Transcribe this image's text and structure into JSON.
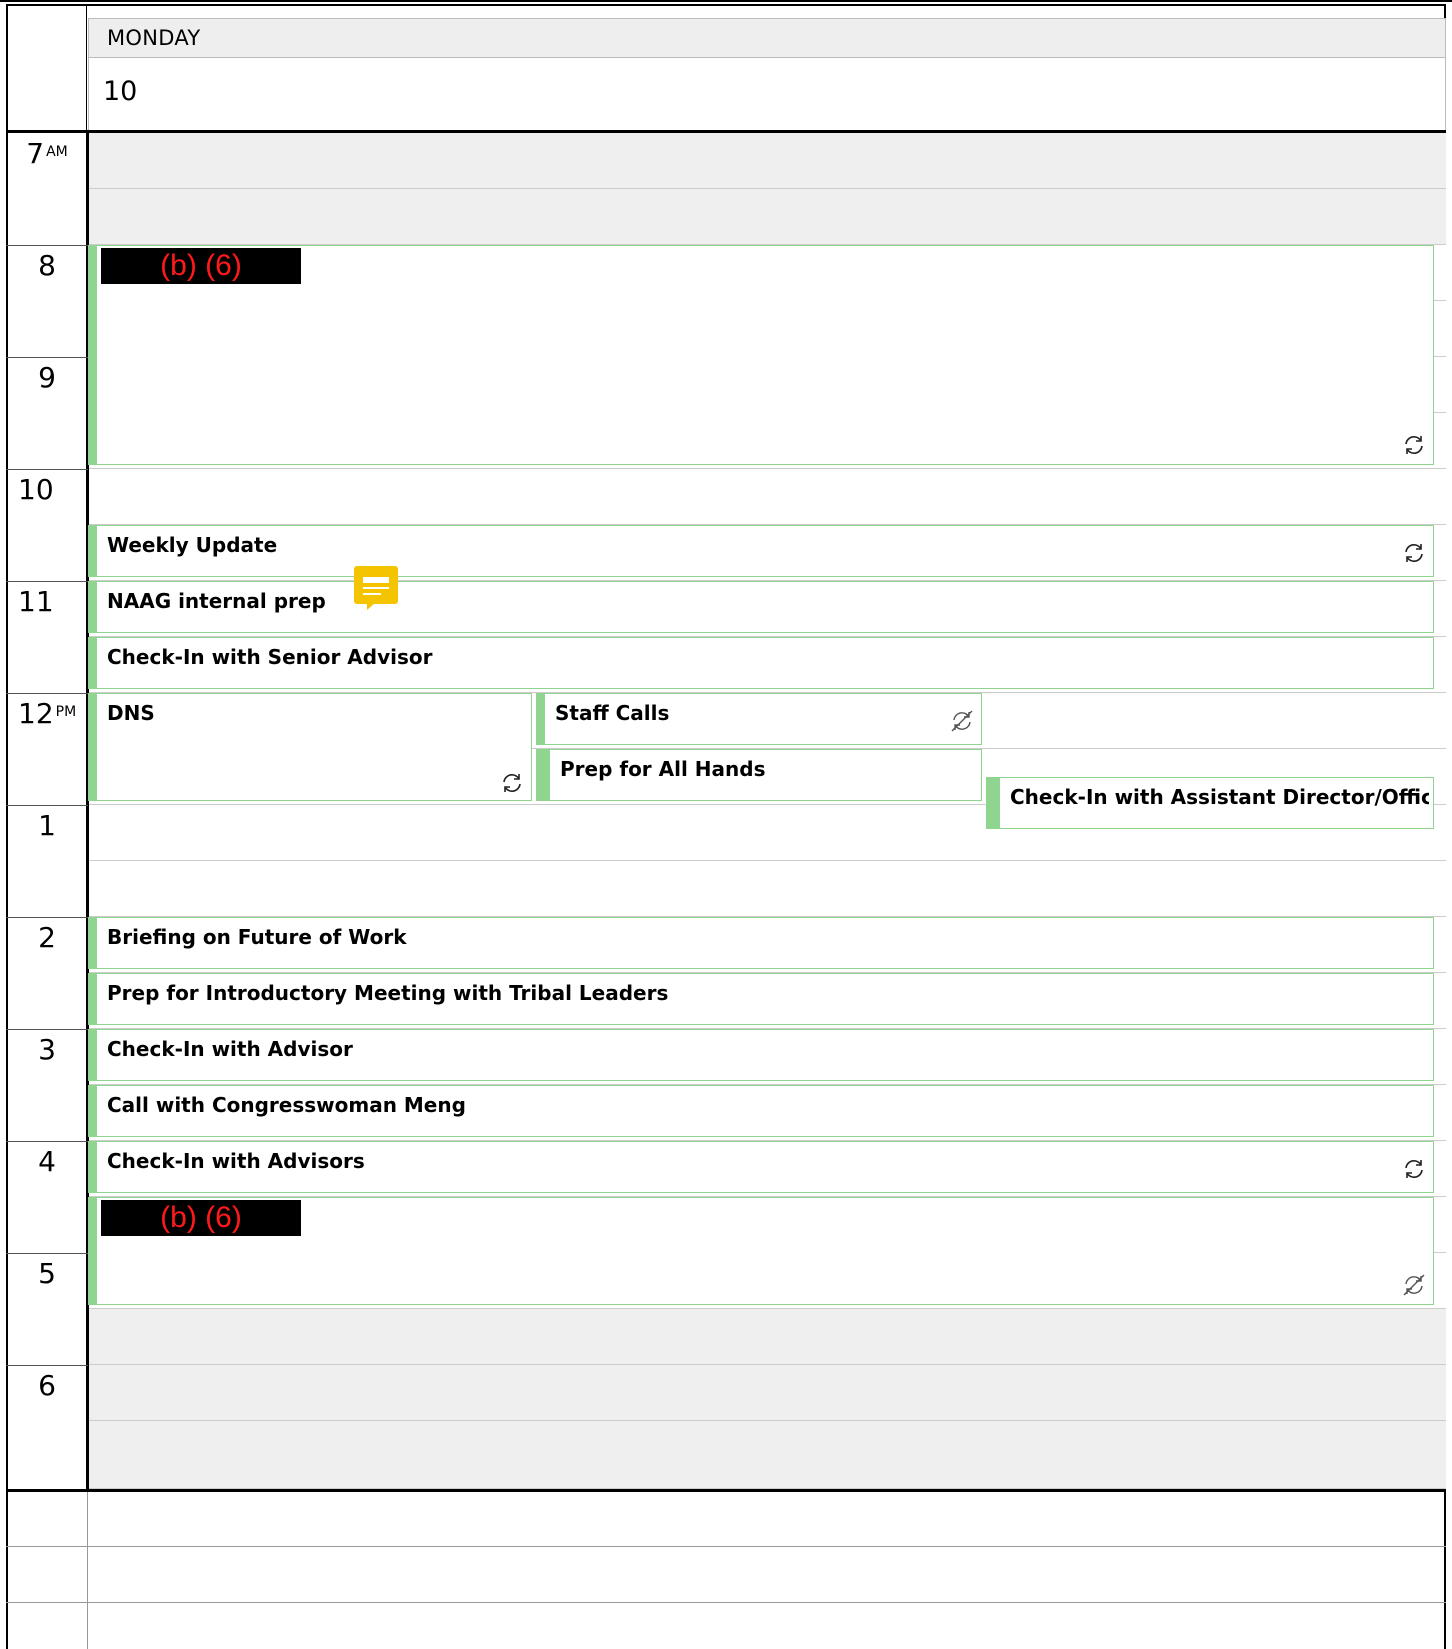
{
  "day": {
    "name": "MONDAY",
    "date": "10"
  },
  "hours": [
    {
      "label": "7",
      "suffix": "AM"
    },
    {
      "label": "8",
      "suffix": ""
    },
    {
      "label": "9",
      "suffix": ""
    },
    {
      "label": "10",
      "suffix": ""
    },
    {
      "label": "11",
      "suffix": ""
    },
    {
      "label": "12",
      "suffix": "PM"
    },
    {
      "label": "1",
      "suffix": ""
    },
    {
      "label": "2",
      "suffix": ""
    },
    {
      "label": "3",
      "suffix": ""
    },
    {
      "label": "4",
      "suffix": ""
    },
    {
      "label": "5",
      "suffix": ""
    },
    {
      "label": "6",
      "suffix": ""
    }
  ],
  "events": {
    "morning_block": {
      "redaction": "(b) (6)",
      "icon": "recurring-icon"
    },
    "weekly_update": {
      "title": "Weekly Update",
      "icon": "recurring-icon"
    },
    "naag_prep": {
      "title": "NAAG internal prep",
      "icon": "note-icon"
    },
    "senior_advisor": {
      "title": "Check-In with Senior Advisor"
    },
    "dns": {
      "title": "DNS",
      "icon": "recurring-icon"
    },
    "staff_calls": {
      "title": "Staff Calls",
      "icon": "recurring-exception-icon"
    },
    "all_hands": {
      "title": "Prep for All Hands"
    },
    "assistant_director": {
      "title": "Check-In with Assistant Director/Office of"
    },
    "future_of_work": {
      "title": "Briefing on Future of Work"
    },
    "tribal_leaders": {
      "title": "Prep for Introductory Meeting with Tribal Leaders"
    },
    "advisor": {
      "title": "Check-In with Advisor"
    },
    "meng": {
      "title": "Call with Congresswoman Meng"
    },
    "advisors": {
      "title": "Check-In with Advisors",
      "icon": "recurring-icon"
    },
    "afternoon_block": {
      "redaction": "(b) (6)",
      "icon": "recurring-exception-icon"
    }
  },
  "colors": {
    "event_accent": "#8fd58f",
    "redaction_text": "#ff1a1a",
    "note": "#f5c400",
    "off_hours": "#efefef"
  }
}
